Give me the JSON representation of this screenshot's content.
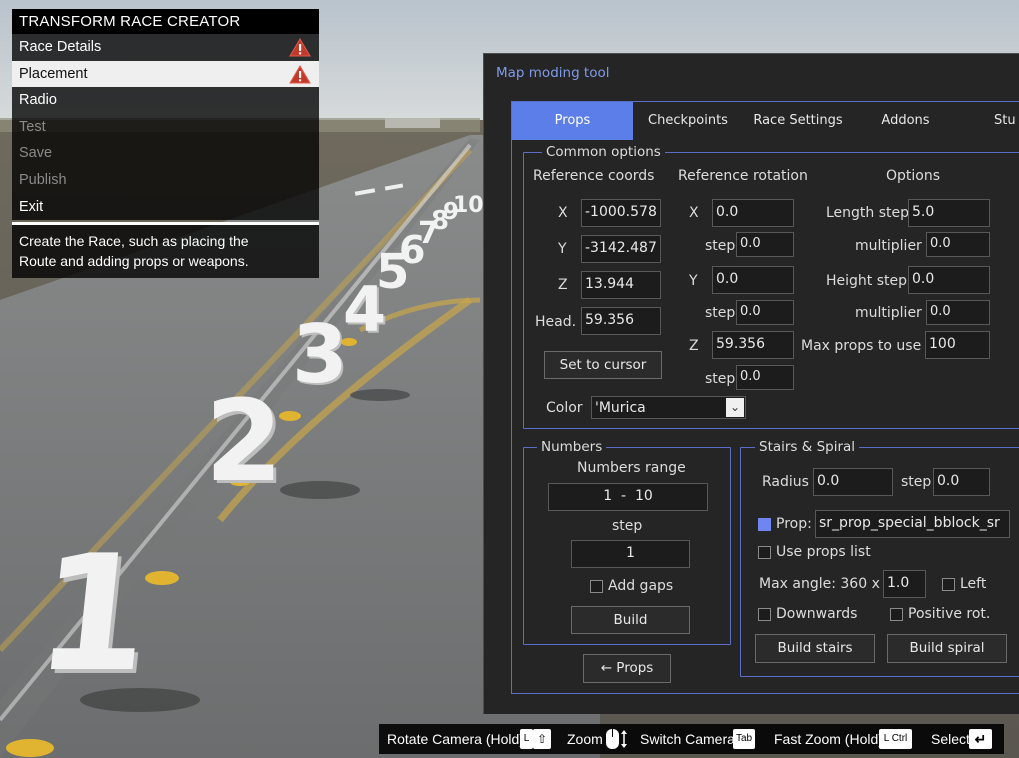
{
  "race_menu": {
    "title": "TRANSFORM RACE CREATOR",
    "items": [
      {
        "label": "Race Details"
      },
      {
        "label": "Placement"
      },
      {
        "label": "Radio"
      },
      {
        "label": "Test"
      },
      {
        "label": "Save"
      },
      {
        "label": "Publish"
      },
      {
        "label": "Exit"
      }
    ],
    "description": "Create the Race, such as placing the\nRoute and adding props or weapons."
  },
  "scene": {
    "numbers": [
      "1",
      "2",
      "3",
      "4",
      "5",
      "6",
      "7",
      "8",
      "9",
      "10"
    ]
  },
  "tool": {
    "title": "Map moding tool",
    "tabs": [
      "Props",
      "Checkpoints",
      "Race Settings",
      "Addons",
      "Stu"
    ],
    "common": {
      "legend": "Common options",
      "ref_coords_label": "Reference coords",
      "ref_rotation_label": "Reference rotation",
      "options_label": "Options",
      "x_label": "X",
      "x_value": "-1000.578",
      "y_label": "Y",
      "y_value": "-3142.487",
      "z_label": "Z",
      "z_value": "13.944",
      "head_label": "Head.",
      "head_value": "59.356",
      "set_cursor_label": "Set to cursor",
      "rot_x_label": "X",
      "rot_x_value": "0.0",
      "rot_y_label": "Y",
      "rot_y_value": "0.0",
      "rot_z_label": "Z",
      "rot_z_value": "59.356",
      "step_label": "step",
      "rot_x_step": "0.0",
      "rot_y_step": "0.0",
      "rot_z_step": "0.0",
      "length_step_label": "Length step",
      "length_step_value": "5.0",
      "multiplier_label": "multiplier",
      "length_multiplier": "0.0",
      "height_step_label": "Height step",
      "height_step_value": "0.0",
      "height_multiplier": "0.0",
      "max_props_label": "Max props to use",
      "max_props_value": "100",
      "color_label": "Color",
      "color_value": "'Murica"
    },
    "numbers": {
      "legend": "Numbers",
      "range_label": "Numbers range",
      "range_value": "1  -  10",
      "step_label": "step",
      "step_value": "1",
      "add_gaps_label": "Add gaps",
      "add_gaps_checked": false,
      "build_label": "Build"
    },
    "stairs": {
      "legend": "Stairs & Spiral",
      "radius_label": "Radius",
      "radius_value": "0.0",
      "step_label": "step",
      "step_value": "0.0",
      "prop_label": "Prop:",
      "prop_value": "sr_prop_special_bblock_sr",
      "prop_checked": true,
      "use_props_list_label": "Use props list",
      "max_angle_label": "Max angle: 360 x",
      "max_angle_value": "1.0",
      "left_label": "Left",
      "downwards_label": "Downwards",
      "positive_rot_label": "Positive rot.",
      "build_stairs_label": "Build stairs",
      "build_spiral_label": "Build spiral"
    },
    "back_button_label": "← Props"
  },
  "hints": [
    {
      "label": "Rotate Camera (Hold)",
      "keys": [
        "L",
        "⇧"
      ]
    },
    {
      "label": "Zoom",
      "keys": []
    },
    {
      "label": "Switch Camera",
      "keys": [
        "Tab"
      ]
    },
    {
      "label": "Fast Zoom (Hold)",
      "keys": [
        "L Ctrl"
      ]
    },
    {
      "label": "Select",
      "keys": [
        "↵"
      ]
    }
  ],
  "colors": {
    "accent": "#5b7ee8",
    "tool_bg": "#252526",
    "warning": "#c0392b"
  }
}
